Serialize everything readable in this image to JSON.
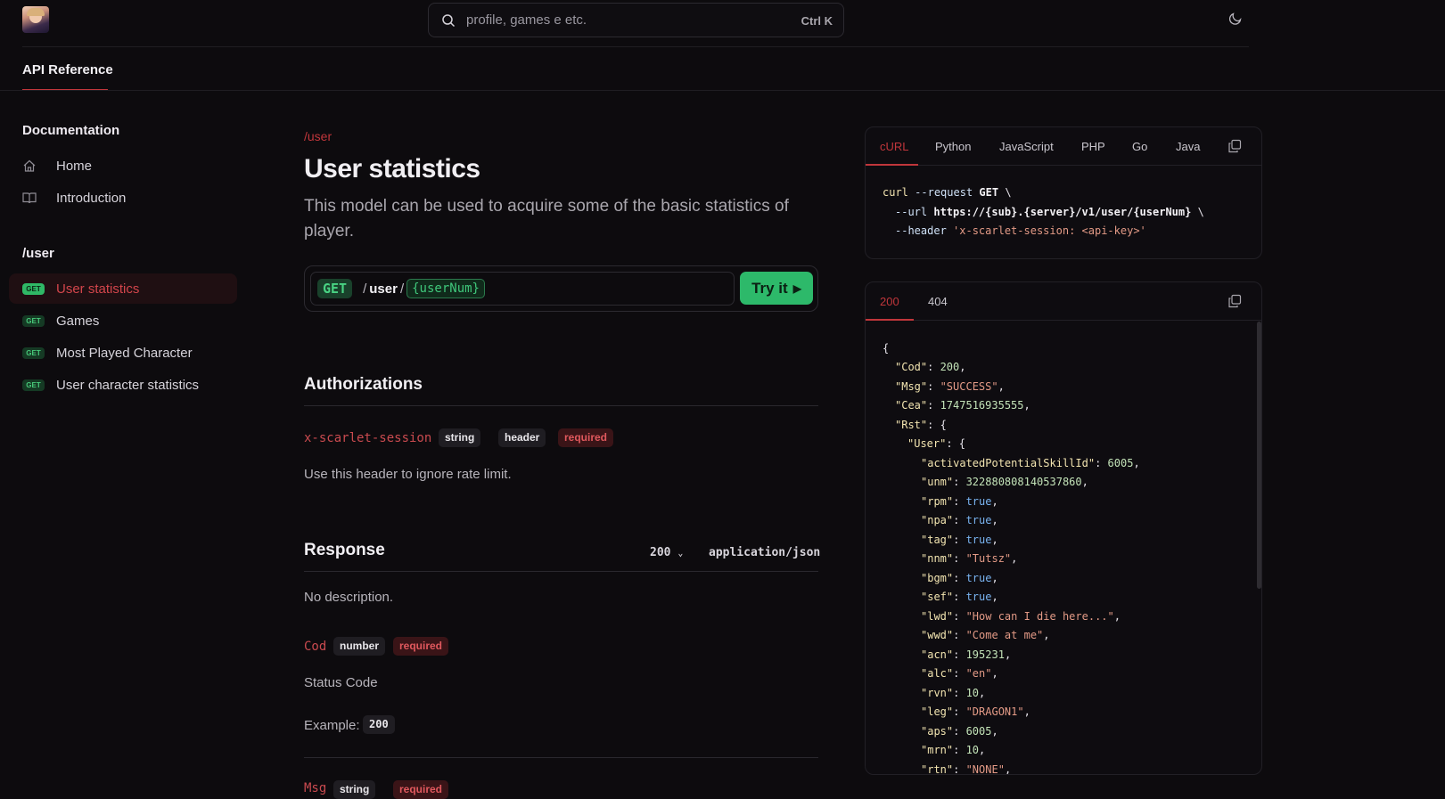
{
  "header": {
    "search_placeholder": "profile, games e etc.",
    "search_shortcut": "Ctrl K"
  },
  "tabs": {
    "active": "API Reference"
  },
  "sidebar": {
    "sections": [
      {
        "title": "Documentation",
        "items": [
          {
            "label": "Home",
            "icon": "home-icon"
          },
          {
            "label": "Introduction",
            "icon": "book-icon"
          }
        ]
      },
      {
        "title": "/user",
        "items": [
          {
            "label": "User statistics",
            "badge": "GET",
            "active": true
          },
          {
            "label": "Games",
            "badge": "GET"
          },
          {
            "label": "Most Played Character",
            "badge": "GET"
          },
          {
            "label": "User character statistics",
            "badge": "GET"
          }
        ]
      }
    ]
  },
  "main": {
    "breadcrumb": "/user",
    "title": "User statistics",
    "description": "This model can be used to acquire some of the basic statistics of player.",
    "endpoint": {
      "method": "GET",
      "seg1": "user",
      "param": "{userNum}",
      "try_label": "Try it"
    },
    "authorizations": {
      "title": "Authorizations",
      "field": "x-scarlet-session",
      "chips": [
        "string",
        "header",
        "required"
      ],
      "description": "Use this header to ignore rate limit."
    },
    "response": {
      "title": "Response",
      "status": "200",
      "content_type": "application/json",
      "description": "No description.",
      "fields": [
        {
          "name": "Cod",
          "type": "number",
          "required": "required",
          "desc": "Status Code",
          "example_label": "Example:",
          "example": "200"
        },
        {
          "name": "Msg",
          "type": "string",
          "required": "required"
        }
      ]
    }
  },
  "request_panel": {
    "tabs": [
      "cURL",
      "Python",
      "JavaScript",
      "PHP",
      "Go",
      "Java"
    ],
    "active": "cURL",
    "code": {
      "l1_cmd": "curl",
      "l1_flag": "--request",
      "l1_method": "GET",
      "l2_flag": "--url",
      "l2_url": "https://{sub}.{server}/v1/user/{userNum}",
      "l3_flag": "--header",
      "l3_value": "'x-scarlet-session: <api-key>'"
    }
  },
  "response_panel": {
    "tabs": [
      "200",
      "404"
    ],
    "active": "200",
    "json": {
      "Cod": "200",
      "Msg": "\"SUCCESS\"",
      "Cea": "1747516935555",
      "activatedPotentialSkillId": "6005",
      "unm": "3228808081405378 60",
      "unm_value": "3228808081405378 60",
      "rpm": "true",
      "npa": "true",
      "tag": "true",
      "nnm": "\"Tutsz\"",
      "bgm": "true",
      "sef": "true",
      "lwd": "\"How can I die here...\"",
      "wwd": "\"Come at me\"",
      "acn": "195231",
      "alc": "\"en\"",
      "rvn": "10",
      "leg": "\"DRAGON1\"",
      "aps": "6005",
      "mrn": "10",
      "rtn": "\"NONE\""
    }
  }
}
